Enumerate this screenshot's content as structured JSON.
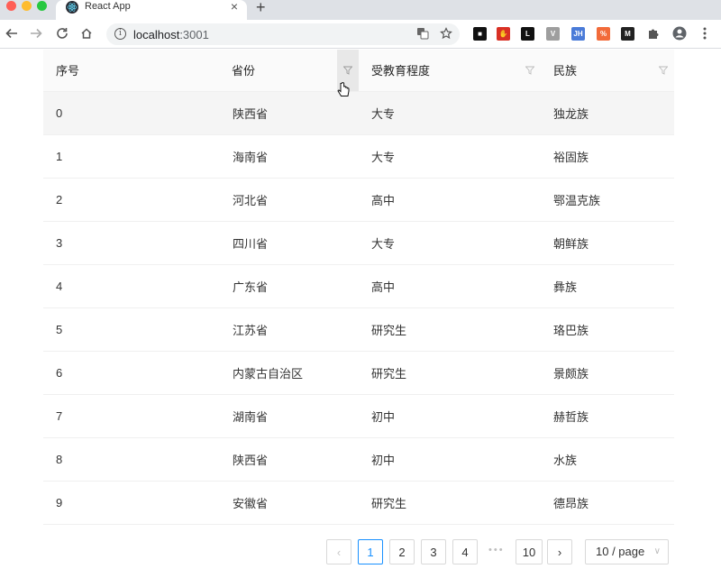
{
  "browser": {
    "tab_title": "React App",
    "tab_close": "×",
    "new_tab": "+",
    "url_host": "localhost",
    "url_port": ":3001",
    "extensions": [
      {
        "name": "ext-square",
        "label": "■",
        "color": "#111111"
      },
      {
        "name": "ext-shield",
        "label": "✋",
        "color": "#d93025"
      },
      {
        "name": "ext-l",
        "label": "L",
        "color": "#111111"
      },
      {
        "name": "ext-v",
        "label": "V",
        "color": "#9e9e9e"
      },
      {
        "name": "ext-jh",
        "label": "JH",
        "color": "#4a7bd8"
      },
      {
        "name": "ext-orange",
        "label": "%",
        "color": "#f26b3a"
      },
      {
        "name": "ext-m",
        "label": "M",
        "color": "#222222"
      }
    ]
  },
  "table": {
    "headers": {
      "index": "序号",
      "province": "省份",
      "education": "受教育程度",
      "ethnicity": "民族"
    },
    "rows": [
      {
        "index": "0",
        "province": "陕西省",
        "education": "大专",
        "ethnicity": "独龙族"
      },
      {
        "index": "1",
        "province": "海南省",
        "education": "大专",
        "ethnicity": "裕固族"
      },
      {
        "index": "2",
        "province": "河北省",
        "education": "高中",
        "ethnicity": "鄂温克族"
      },
      {
        "index": "3",
        "province": "四川省",
        "education": "大专",
        "ethnicity": "朝鲜族"
      },
      {
        "index": "4",
        "province": "广东省",
        "education": "高中",
        "ethnicity": "彝族"
      },
      {
        "index": "5",
        "province": "江苏省",
        "education": "研究生",
        "ethnicity": "珞巴族"
      },
      {
        "index": "6",
        "province": "内蒙古自治区",
        "education": "研究生",
        "ethnicity": "景颇族"
      },
      {
        "index": "7",
        "province": "湖南省",
        "education": "初中",
        "ethnicity": "赫哲族"
      },
      {
        "index": "8",
        "province": "陕西省",
        "education": "初中",
        "ethnicity": "水族"
      },
      {
        "index": "9",
        "province": "安徽省",
        "education": "研究生",
        "ethnicity": "德昂族"
      }
    ]
  },
  "pagination": {
    "prev": "‹",
    "next": "›",
    "pages": [
      "1",
      "2",
      "3",
      "4"
    ],
    "ellipsis": "•••",
    "last": "10",
    "current": "1",
    "page_size": "10 / page",
    "page_size_arrow": "∨"
  },
  "colors": {
    "accent": "#1890ff",
    "header_bg": "#fafafa",
    "border": "#f0f0f0"
  }
}
